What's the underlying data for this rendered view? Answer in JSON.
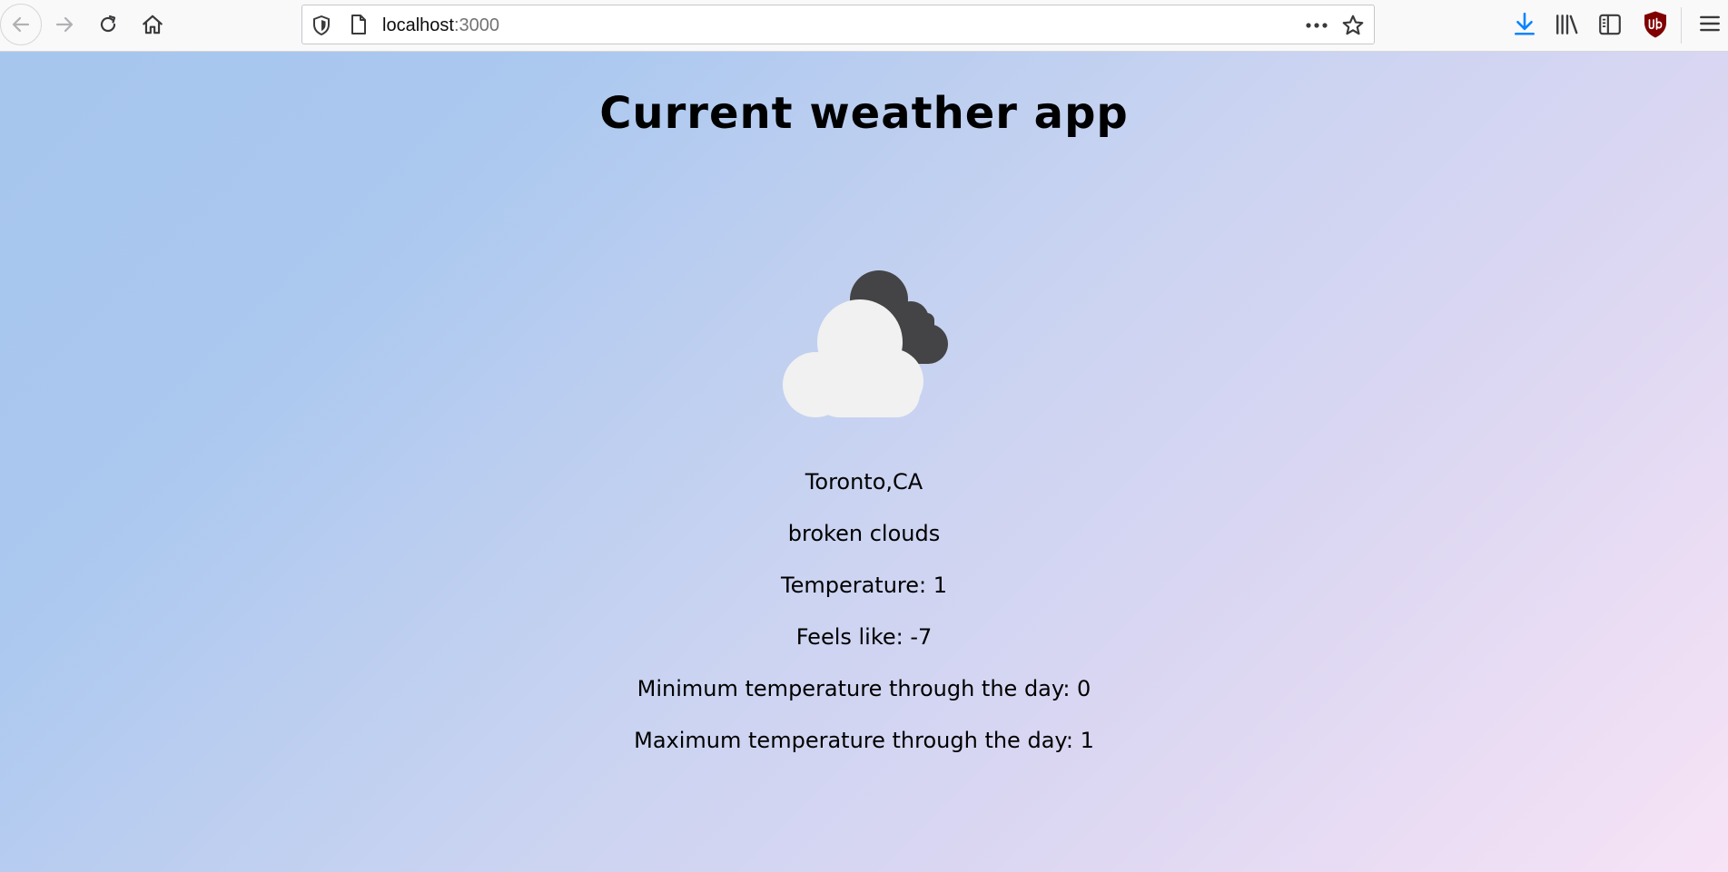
{
  "browser": {
    "url_host": "localhost",
    "url_port": ":3000",
    "icons": {
      "back": "back-arrow-icon",
      "forward": "forward-arrow-icon",
      "reload": "reload-icon",
      "home": "home-icon",
      "shield": "tracking-shield-icon",
      "page": "page-icon",
      "more": "more-dots-icon",
      "bookmark": "star-icon",
      "downloads": "download-icon",
      "library": "library-icon",
      "sidebar": "sidebar-icon",
      "ublock": "ublock-origin-icon",
      "menu": "hamburger-menu-icon"
    },
    "colors": {
      "download_accent": "#0a84ff",
      "ublock": "#800000"
    }
  },
  "app": {
    "title": "Current weather app",
    "weather_icon": "broken-clouds-icon",
    "location": "Toronto,CA",
    "description": "broken clouds",
    "temperature_text": "Temperature: 1",
    "feels_like_text": "Feels like: -7",
    "min_temp_text": "Minimum temperature through the day: 0",
    "max_temp_text": "Maximum temperature through the day: 1",
    "colors": {
      "gradient_start": "#a6c6ee",
      "gradient_end": "#f7e3f6",
      "cloud_front": "#f1f1f1",
      "cloud_back": "#444446"
    }
  }
}
